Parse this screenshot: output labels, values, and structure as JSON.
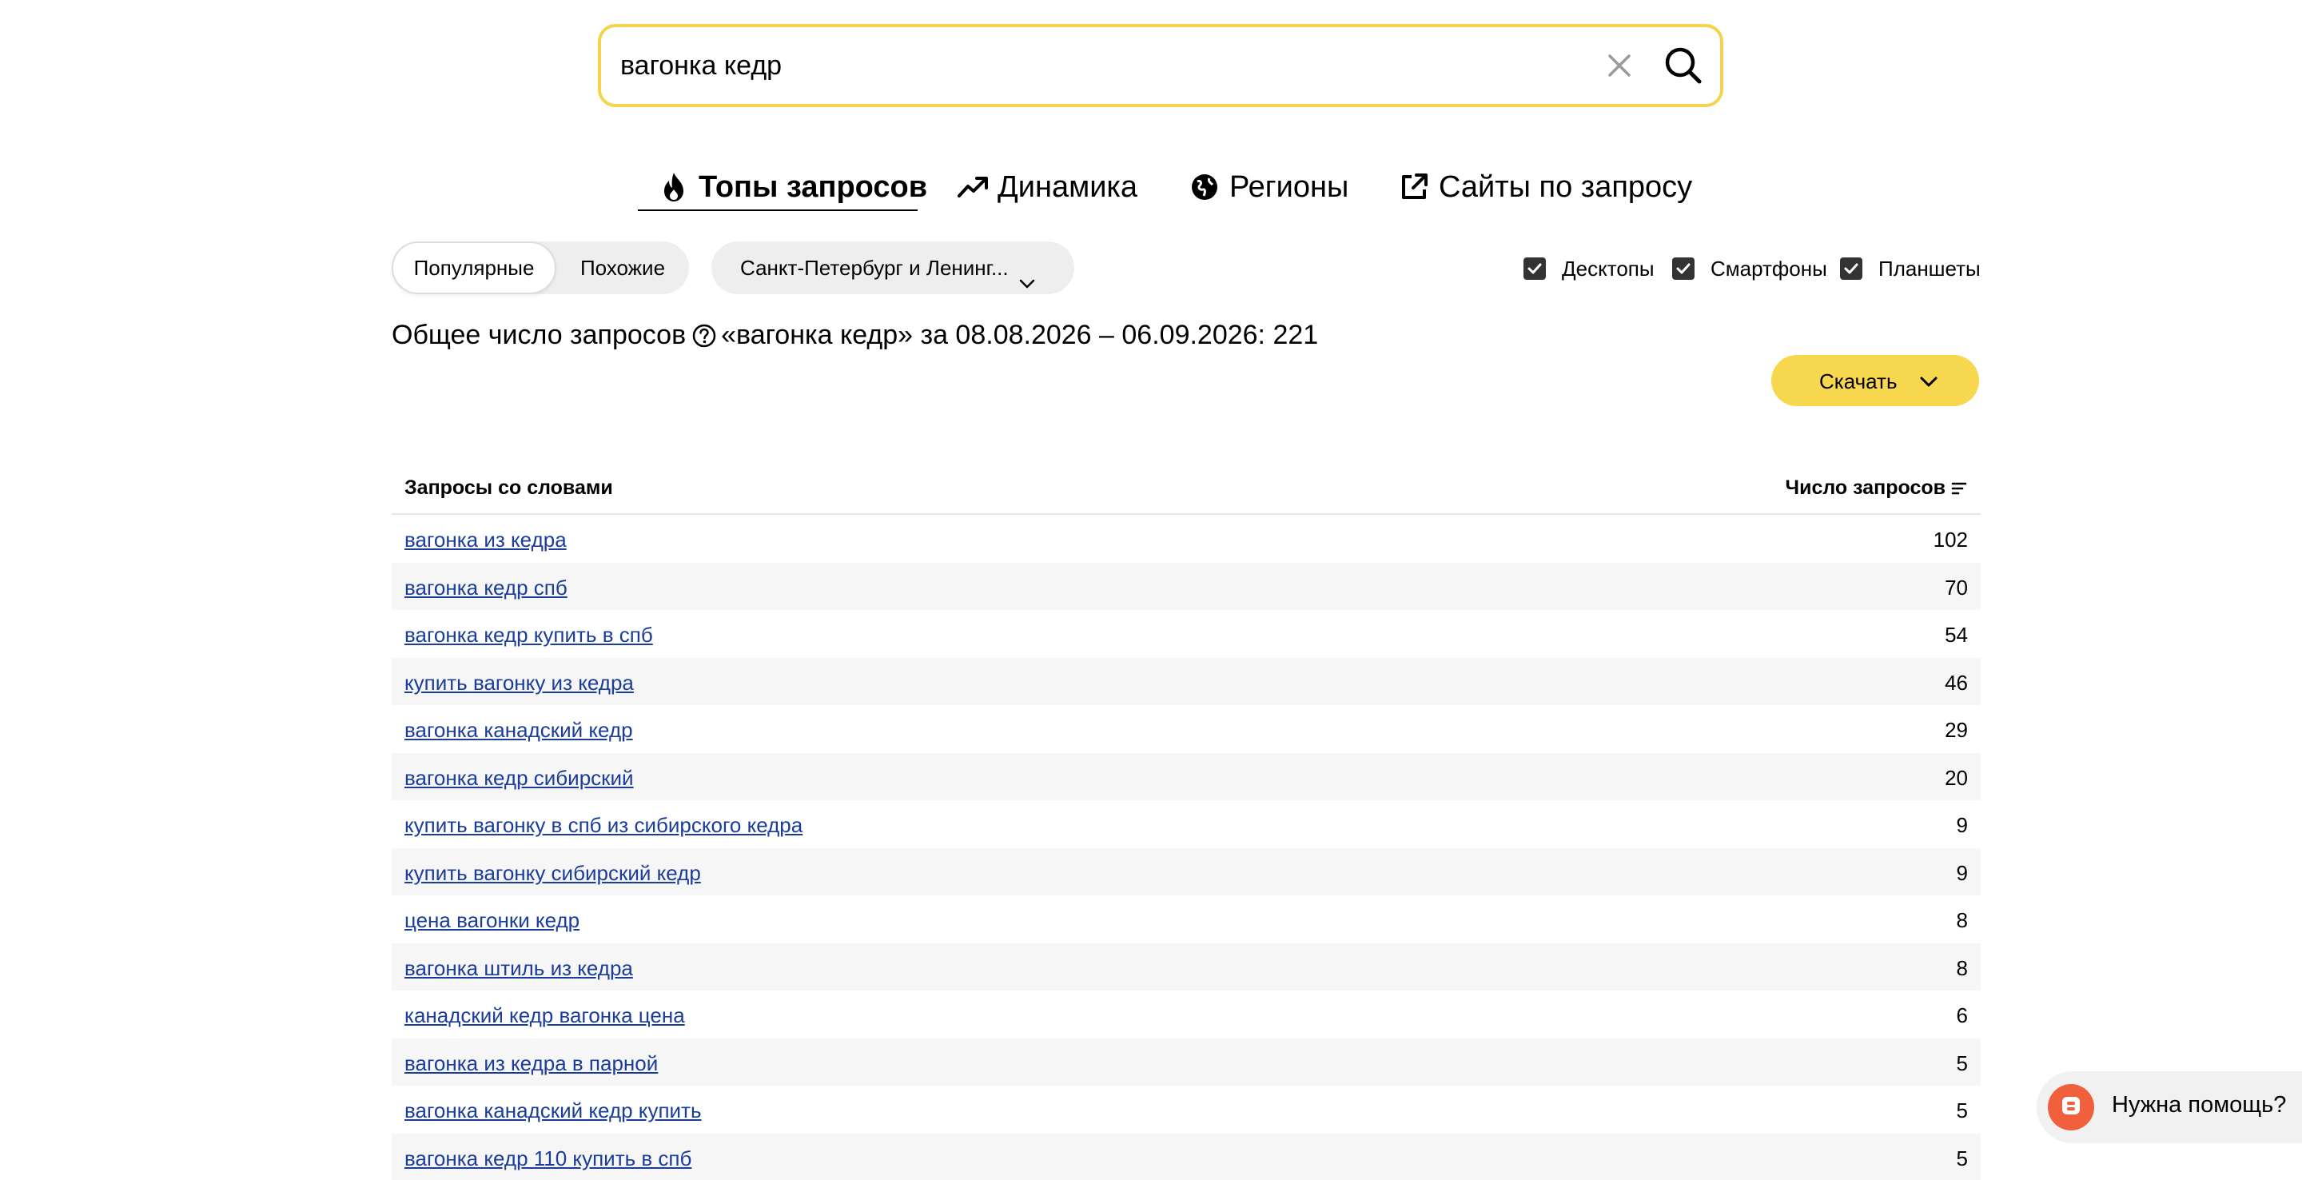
{
  "search": {
    "value": "вагонка кедр",
    "clear_icon": "close-icon",
    "search_icon": "search-icon"
  },
  "tabs": [
    {
      "label": "Топы запросов",
      "icon": "fire-icon",
      "active": true
    },
    {
      "label": "Динамика",
      "icon": "trend-icon",
      "active": false
    },
    {
      "label": "Регионы",
      "icon": "globe-icon",
      "active": false
    },
    {
      "label": "Сайты по запросу",
      "icon": "external-link-icon",
      "active": false
    }
  ],
  "segment": {
    "popular": "Популярные",
    "similar": "Похожие",
    "selected": "Популярные"
  },
  "region": {
    "label": "Санкт-Петербург и Ленинг..."
  },
  "devices": [
    {
      "label": "Десктопы",
      "checked": true
    },
    {
      "label": "Смартфоны",
      "checked": true
    },
    {
      "label": "Планшеты",
      "checked": true
    }
  ],
  "summary": {
    "prefix": "Общее число запросов",
    "suffix": "«вагонка кедр» за 08.08.2026 – 06.09.2026: 221"
  },
  "download": {
    "label": "Скачать"
  },
  "table": {
    "col_query": "Запросы со словами",
    "col_count": "Число запросов",
    "rows": [
      {
        "query": "вагонка из кедра",
        "count": "102"
      },
      {
        "query": "вагонка кедр спб",
        "count": "70"
      },
      {
        "query": "вагонка кедр купить в спб",
        "count": "54"
      },
      {
        "query": "купить вагонку из кедра",
        "count": "46"
      },
      {
        "query": "вагонка канадский кедр",
        "count": "29"
      },
      {
        "query": "вагонка кедр сибирский",
        "count": "20"
      },
      {
        "query": "купить вагонку в спб из сибирского кедра",
        "count": "9"
      },
      {
        "query": "купить вагонку сибирский кедр",
        "count": "9"
      },
      {
        "query": "цена вагонки кедр",
        "count": "8"
      },
      {
        "query": "вагонка штиль из кедра",
        "count": "8"
      },
      {
        "query": "канадский кедр вагонка цена",
        "count": "6"
      },
      {
        "query": "вагонка из кедра в парной",
        "count": "5"
      },
      {
        "query": "вагонка канадский кедр купить",
        "count": "5"
      },
      {
        "query": "вагонка кедр 110 купить в спб",
        "count": "5"
      }
    ]
  },
  "help_widget": {
    "label": "Нужна помощь?"
  },
  "colors": {
    "search_border": "#f4d44d",
    "download_bg": "#f7d74e",
    "link": "#1a3d9c",
    "row_alt": "#f6f6f6",
    "help_avatar": "#f0603c"
  }
}
